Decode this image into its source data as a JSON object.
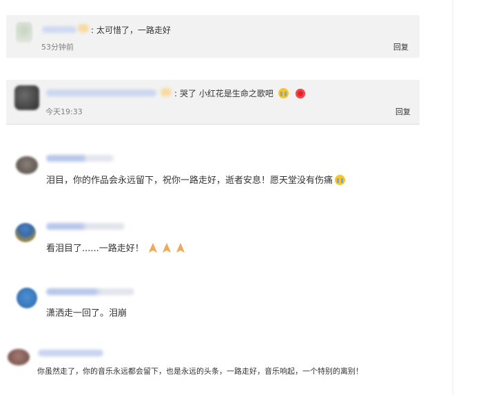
{
  "replies": [
    {
      "text": "太可惜了，一路走好",
      "time": "53分钟前",
      "reply_label": "回复"
    },
    {
      "text": "哭了 小红花是生命之歌吧",
      "time": "今天19:33",
      "reply_label": "回复"
    }
  ],
  "comments": [
    {
      "text": "泪目，你的作品会永远留下，祝你一路走好，逝者安息！愿天堂没有伤痛"
    },
    {
      "text": "看泪目了......一路走好！"
    },
    {
      "text": "潇洒走一回了。泪崩"
    },
    {
      "text": "你虽然走了，你的音乐永远都会留下，也是永远的头条，一路走好，音乐响起，一个特别的离别！"
    }
  ],
  "colors": {
    "reply_bg": "#f2f2f2",
    "blur_name": "#c7d3ef"
  },
  "icons": [
    "crying-face-icon",
    "red-flower-icon",
    "praying-hands-icon"
  ]
}
